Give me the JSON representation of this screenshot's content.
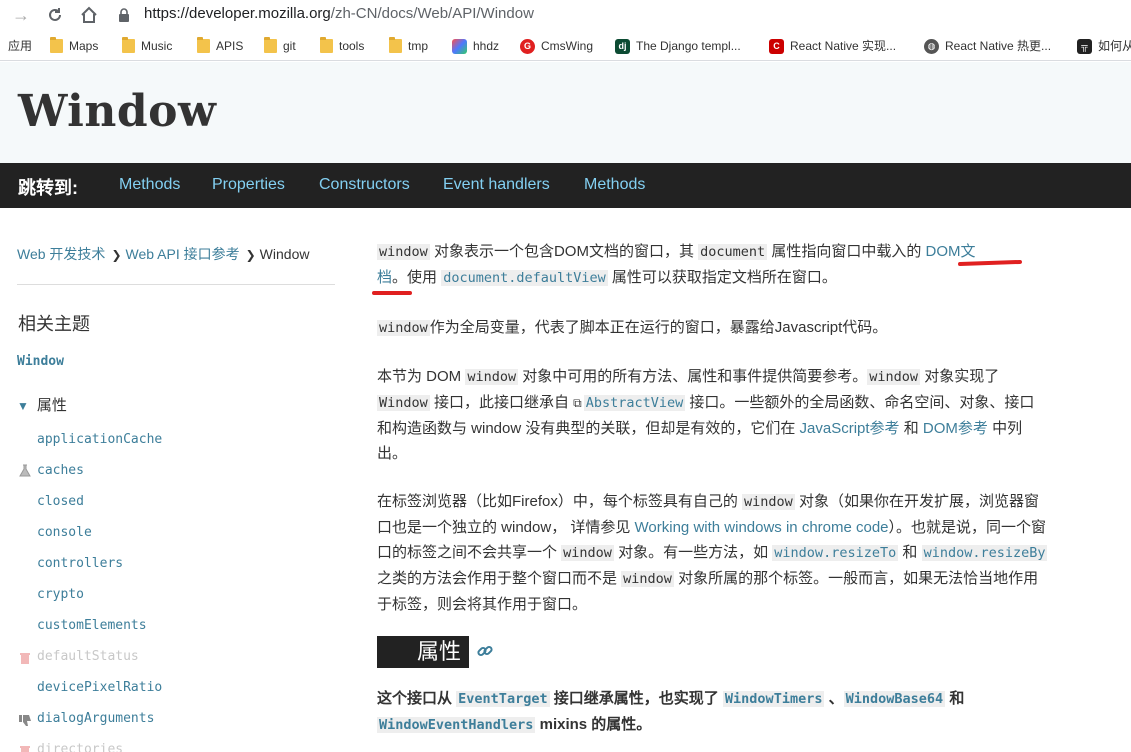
{
  "browser": {
    "url_host": "https://developer.mozilla.org",
    "url_path": "/zh-CN/docs/Web/API/Window",
    "bookmarks": [
      {
        "label": "应用",
        "icon": "apps-icon"
      },
      {
        "label": "Maps",
        "icon": "folder-icon"
      },
      {
        "label": "Music",
        "icon": "folder-icon"
      },
      {
        "label": "APIS",
        "icon": "folder-icon"
      },
      {
        "label": "git",
        "icon": "folder-icon"
      },
      {
        "label": "tools",
        "icon": "folder-icon"
      },
      {
        "label": "tmp",
        "icon": "folder-icon"
      },
      {
        "label": "hhdz",
        "icon": "hhdz-icon"
      },
      {
        "label": "CmsWing",
        "icon": "cmswing-icon"
      },
      {
        "label": "The Django templ...",
        "icon": "django-icon"
      },
      {
        "label": "React Native 实现...",
        "icon": "csdn-icon"
      },
      {
        "label": "React Native 热更...",
        "icon": "globe-icon"
      },
      {
        "label": "如何从",
        "icon": "bookmark-icon"
      }
    ]
  },
  "page": {
    "title": "Window",
    "jump_label": "跳转到:",
    "jump_links": [
      "Methods",
      "Properties",
      "Constructors",
      "Event handlers",
      "Methods"
    ]
  },
  "sidebar": {
    "breadcrumb": [
      "Web 开发技术",
      "Web API 接口参考",
      "Window"
    ],
    "related_title": "相关主题",
    "window_link": "Window",
    "props_heading": "属性",
    "items": [
      {
        "label": "applicationCache",
        "status": "normal"
      },
      {
        "label": "caches",
        "status": "experimental"
      },
      {
        "label": "closed",
        "status": "normal"
      },
      {
        "label": "console",
        "status": "normal"
      },
      {
        "label": "controllers",
        "status": "normal"
      },
      {
        "label": "crypto",
        "status": "normal"
      },
      {
        "label": "customElements",
        "status": "normal"
      },
      {
        "label": "defaultStatus",
        "status": "deprecated"
      },
      {
        "label": "devicePixelRatio",
        "status": "normal"
      },
      {
        "label": "dialogArguments",
        "status": "non-standard"
      },
      {
        "label": "directories",
        "status": "deprecated"
      }
    ]
  },
  "article": {
    "p1": {
      "code1": "window",
      "t1": " 对象表示一个包含DOM文档的窗口，其 ",
      "code2": "document",
      "t2": " 属性指向窗口中载入的 ",
      "link1a": "DOM文",
      "link1b": "档",
      "t3": "。使用 ",
      "code3": "document.defaultView",
      "t4": " 属性可以获取指定文档所在窗口。"
    },
    "p2": {
      "code1": "window",
      "t1": "作为全局变量，代表了脚本正在运行的窗口，暴露给Javascript代码。"
    },
    "p3": {
      "t1": "本节为 DOM ",
      "code1": "window",
      "t2": " 对象中可用的所有方法、属性和事件提供简要参考。",
      "code2": "window",
      "t3": " 对象实现了 ",
      "code3": "Window",
      "t4": " 接口，此接口继承自 ",
      "code4": "AbstractView",
      "t5": " 接口。一些额外的全局函数、命名空间、对象、接口和构造函数与 window 没有典型的关联，但却是有效的，它们在 ",
      "link1": "JavaScript参考",
      "t6": " 和 ",
      "link2": "DOM参考",
      "t7": " 中列出。"
    },
    "p4": {
      "t1": "在标签浏览器（比如Firefox）中，每个标签具有自己的 ",
      "code1": "window",
      "t2": " 对象（如果你在开发扩展，浏览器窗口也是一个独立的 window， 详情参见 ",
      "link1": "Working with windows in chrome code",
      "t3": "）。也就是说，同一个窗口的标签之间不会共享一个 ",
      "code2": "window",
      "t4": " 对象。有一些方法，如 ",
      "code3": "window.resizeTo",
      "t5": " 和 ",
      "code4": "window.resizeBy",
      "t6": " 之类的方法会作用于整个窗口而不是 ",
      "code5": "window",
      "t7": " 对象所属的那个标签。一般而言，如果无法恰当地作用于标签，则会将其作用于窗口。"
    },
    "section_heading": "属性",
    "p5": {
      "t1": "这个接口从 ",
      "code1": "EventTarget",
      "t2": " 接口继承属性，也实现了 ",
      "code2": "WindowTimers",
      "t3": " 、",
      "code3": "WindowBase64",
      "t4": " 和 ",
      "code4": "WindowEventHandlers",
      "t5": " mixins 的属性。"
    }
  },
  "colors": {
    "link": "#3d7e9a",
    "jump_link": "#83d0f2",
    "header_bg": "#f5f9fa",
    "jumpbar_bg": "#222222",
    "annotation_red": "#e02020"
  }
}
